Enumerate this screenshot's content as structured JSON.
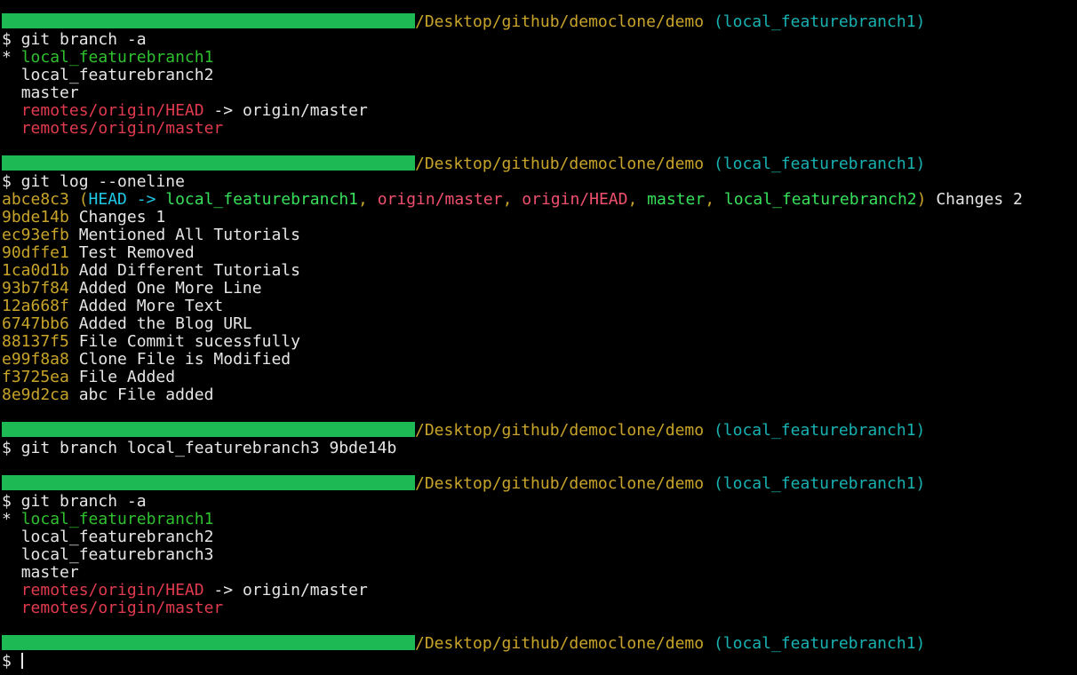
{
  "prompt": {
    "path": "/Desktop/github/democlone/demo",
    "branch": "(local_featurebranch1)"
  },
  "blocks": [
    {
      "command": "$ git branch -a",
      "output": [
        {
          "prefix": "* ",
          "text": "local_featurebranch1",
          "color": "green"
        },
        {
          "prefix": "  ",
          "text": "local_featurebranch2",
          "color": "white"
        },
        {
          "prefix": "  ",
          "text": "master",
          "color": "white"
        },
        {
          "prefix": "  ",
          "text": "remotes/origin/HEAD",
          "color": "red",
          "suffix": " -> origin/master"
        },
        {
          "prefix": "  ",
          "text": "remotes/origin/master",
          "color": "red"
        }
      ]
    },
    {
      "command": "$ git log --oneline",
      "head_commit": {
        "hash": "abce8c3",
        "open_paren": "(",
        "head": "HEAD -> ",
        "refs": [
          {
            "text": "local_featurebranch1",
            "color": "lgreen"
          },
          {
            "text": "origin/master",
            "color": "pink"
          },
          {
            "text": "origin/HEAD",
            "color": "pink"
          },
          {
            "text": "master",
            "color": "lgreen"
          },
          {
            "text": "local_featurebranch2",
            "color": "lgreen"
          }
        ],
        "separator": ", ",
        "close_paren": ")",
        "message": " Changes 2"
      },
      "commits": [
        {
          "hash": "9bde14b",
          "message": "Changes 1"
        },
        {
          "hash": "ec93efb",
          "message": "Mentioned All Tutorials"
        },
        {
          "hash": "90dffe1",
          "message": "Test Removed"
        },
        {
          "hash": "1ca0d1b",
          "message": "Add Different Tutorials"
        },
        {
          "hash": "93b7f84",
          "message": "Added One More Line"
        },
        {
          "hash": "12a668f",
          "message": "Added More Text"
        },
        {
          "hash": "6747bb6",
          "message": "Added the Blog URL"
        },
        {
          "hash": "88137f5",
          "message": "File Commit sucessfully"
        },
        {
          "hash": "e99f8a8",
          "message": "Clone File is Modified"
        },
        {
          "hash": "f3725ea",
          "message": "File Added"
        },
        {
          "hash": "8e9d2ca",
          "message": "abc File added"
        }
      ]
    },
    {
      "command": "$ git branch local_featurebranch3 9bde14b"
    },
    {
      "command": "$ git branch -a",
      "output": [
        {
          "prefix": "* ",
          "text": "local_featurebranch1",
          "color": "green"
        },
        {
          "prefix": "  ",
          "text": "local_featurebranch2",
          "color": "white"
        },
        {
          "prefix": "  ",
          "text": "local_featurebranch3",
          "color": "white"
        },
        {
          "prefix": "  ",
          "text": "master",
          "color": "white"
        },
        {
          "prefix": "  ",
          "text": "remotes/origin/HEAD",
          "color": "red",
          "suffix": " -> origin/master"
        },
        {
          "prefix": "  ",
          "text": "remotes/origin/master",
          "color": "red"
        }
      ]
    }
  ],
  "final_prompt_symbol": "$ ",
  "colors": {
    "background": "#000000",
    "redaction": "#1db954",
    "path": "#c8a42a",
    "branch": "#18b2b2",
    "current_branch": "#2ec12e",
    "remote_branch": "#e03a4e",
    "hash": "#c8a42a",
    "head": "#1ec8e6",
    "local_ref": "#37e05a",
    "remote_ref": "#f0506e",
    "text": "#e6e6e6"
  }
}
